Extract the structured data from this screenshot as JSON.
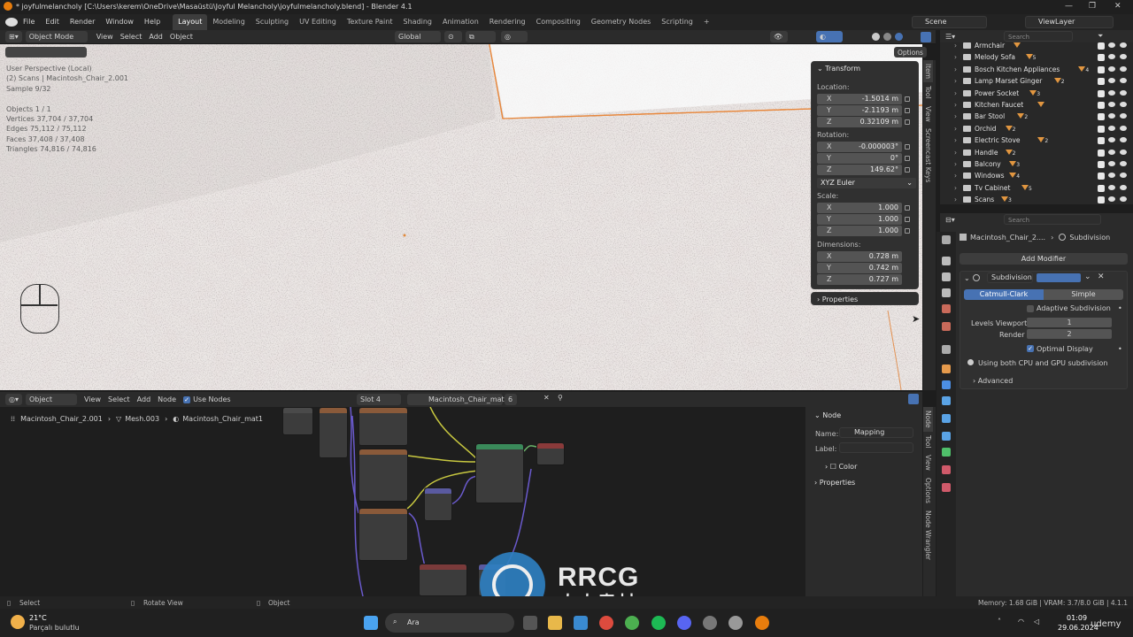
{
  "window": {
    "title": "* joyfulmelancholy [C:\\Users\\kerem\\OneDrive\\Masaüstü\\Joyful Melancholy\\joyfulmelancholy.blend] - Blender 4.1"
  },
  "menu": {
    "items": [
      "File",
      "Edit",
      "Render",
      "Window",
      "Help"
    ],
    "tabs": [
      "Layout",
      "Modeling",
      "Sculpting",
      "UV Editing",
      "Texture Paint",
      "Shading",
      "Animation",
      "Rendering",
      "Compositing",
      "Geometry Nodes",
      "Scripting"
    ],
    "active_tab": "Layout",
    "scene": "Scene",
    "view_layer": "ViewLayer"
  },
  "viewport": {
    "mode": "Object Mode",
    "menus": [
      "View",
      "Select",
      "Add",
      "Object"
    ],
    "orientation": "Global",
    "options_label": "Options",
    "overlay_lines": [
      "User Perspective (Local)",
      "(2) Scans | Macintosh_Chair_2.001",
      "Sample 9/32",
      "",
      "Objects   1 / 1",
      "Vertices  37,704 / 37,704",
      "Edges     75,112 / 75,112",
      "Faces     37,408 / 37,408",
      "Triangles 74,816 / 74,816"
    ],
    "side_tabs": [
      "Item",
      "Tool",
      "View",
      "Screencast Keys"
    ]
  },
  "transform": {
    "title": "Transform",
    "location_label": "Location:",
    "location": [
      {
        "axis": "X",
        "value": "-1.5014 m"
      },
      {
        "axis": "Y",
        "value": "-2.1193 m"
      },
      {
        "axis": "Z",
        "value": "0.32109 m"
      }
    ],
    "rotation_label": "Rotation:",
    "rotation": [
      {
        "axis": "X",
        "value": "-0.000003°"
      },
      {
        "axis": "Y",
        "value": "0°"
      },
      {
        "axis": "Z",
        "value": "149.62°"
      }
    ],
    "rotation_mode": "XYZ Euler",
    "scale_label": "Scale:",
    "scale": [
      {
        "axis": "X",
        "value": "1.000"
      },
      {
        "axis": "Y",
        "value": "1.000"
      },
      {
        "axis": "Z",
        "value": "1.000"
      }
    ],
    "dimensions_label": "Dimensions:",
    "dimensions": [
      {
        "axis": "X",
        "value": "0.728 m"
      },
      {
        "axis": "Y",
        "value": "0.742 m"
      },
      {
        "axis": "Z",
        "value": "0.727 m"
      }
    ],
    "properties_label": "Properties"
  },
  "outliner": {
    "search_placeholder": "Search",
    "rows": [
      "Armchair",
      "Melody Sofa",
      "Bosch Kitchen Appliances",
      "Lamp Marset Ginger",
      "Power Socket",
      "Kitchen Faucet",
      "Bar Stool",
      "Orchid",
      "Electric Stove",
      "Handle",
      "Balcony",
      "Windows",
      "Tv Cabinet",
      "Scans"
    ],
    "badges": [
      "",
      "5",
      "4",
      "2",
      "3",
      "",
      "2",
      "2",
      "2",
      "2",
      "3",
      "4",
      "5",
      "3"
    ]
  },
  "properties": {
    "search_placeholder": "Search",
    "object_name": "Macintosh_Chair_2....",
    "context": "Subdivision",
    "add_modifier": "Add Modifier",
    "modifier_name": "Subdivision",
    "algo_options": [
      "Catmull-Clark",
      "Simple"
    ],
    "algo_selected": "Catmull-Clark",
    "adaptive_label": "Adaptive Subdivision",
    "levels_viewport_label": "Levels Viewport",
    "levels_viewport": "1",
    "render_label": "Render",
    "render_level": "2",
    "optimal_display": "Optimal Display",
    "info": "Using both CPU and GPU subdivision",
    "advanced": "Advanced"
  },
  "node_editor": {
    "mode": "Object",
    "menus": [
      "View",
      "Select",
      "Add",
      "Node"
    ],
    "use_nodes": "Use Nodes",
    "slot": "Slot 4",
    "material": "Macintosh_Chair_mat1",
    "users": "6",
    "breadcrumb": [
      "Macintosh_Chair_2.001",
      "Mesh.003",
      "Macintosh_Chair_mat1"
    ],
    "side_tabs": [
      "Node",
      "Tool",
      "View",
      "Options",
      "Node Wrangler"
    ]
  },
  "node_panel": {
    "title": "Node",
    "name_label": "Name:",
    "name_value": "Mapping",
    "label_label": "Label:",
    "label_value": "",
    "color_label": "Color",
    "properties_label": "Properties"
  },
  "statusbar": {
    "left": [
      "Select",
      "Rotate View",
      "Object"
    ],
    "right": "Memory: 1.68 GiB | VRAM: 3.7/8.0 GiB | 4.1.1"
  },
  "taskbar": {
    "temperature": "21°C",
    "weather": "Parçalı bulutlu",
    "search_label": "Ara",
    "time": "01:09",
    "date": "29.06.2024"
  },
  "watermark": {
    "brand": "RRCG",
    "cn": "人人素材",
    "corner": "udemy"
  }
}
